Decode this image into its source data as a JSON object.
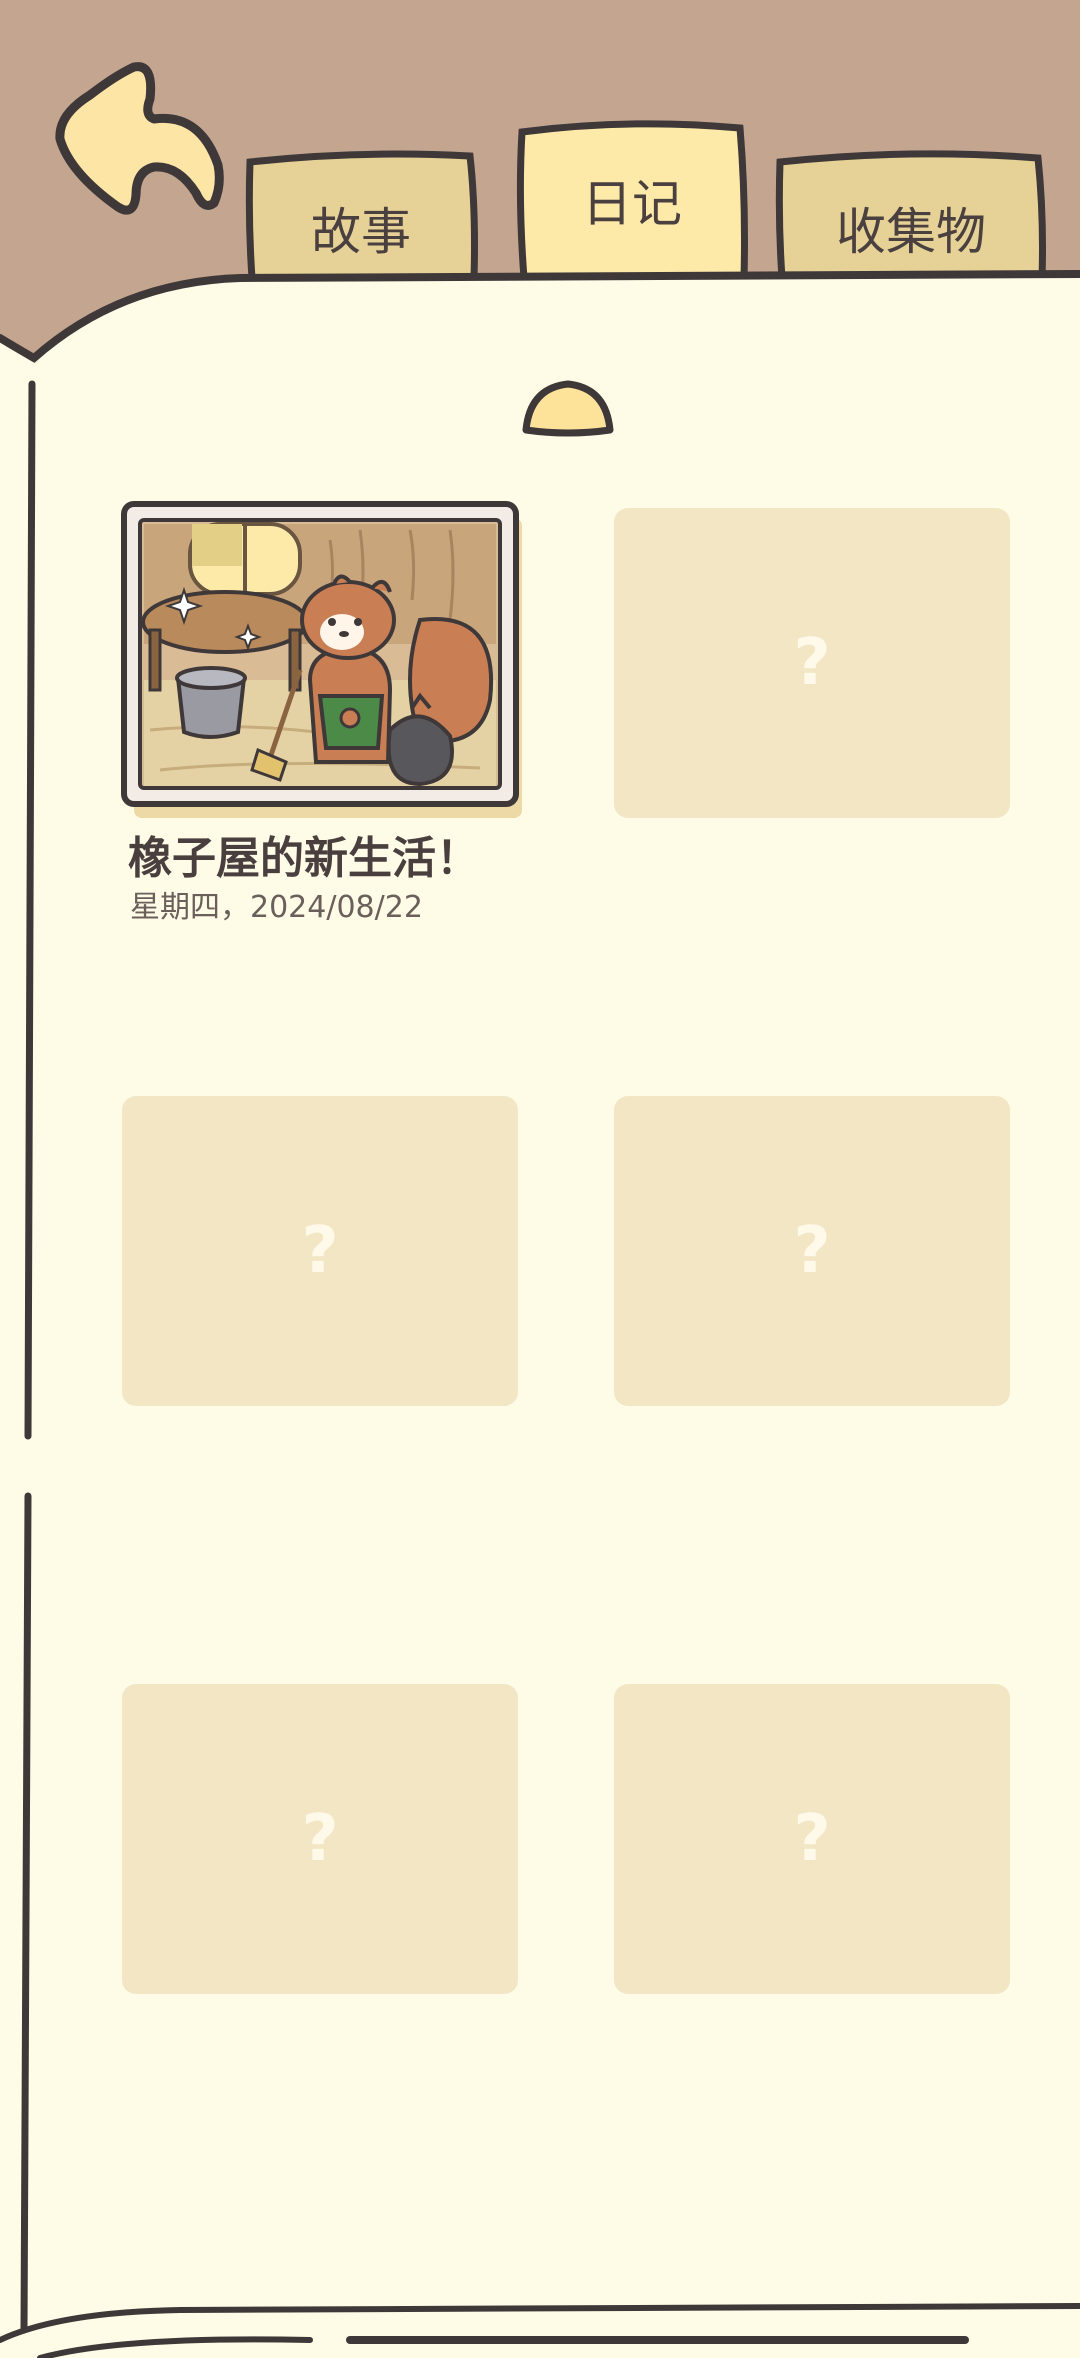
{
  "tabs": [
    {
      "label": "故事",
      "active": false
    },
    {
      "label": "日记",
      "active": true
    },
    {
      "label": "收集物",
      "active": false
    }
  ],
  "entries": [
    {
      "title": "橡子屋的新生活！",
      "date": "星期四，2024/08/22",
      "unlocked": true
    },
    {
      "locked_label": "?",
      "unlocked": false
    },
    {
      "locked_label": "?",
      "unlocked": false
    },
    {
      "locked_label": "?",
      "unlocked": false
    },
    {
      "locked_label": "?",
      "unlocked": false
    },
    {
      "locked_label": "?",
      "unlocked": false
    }
  ],
  "colors": {
    "background": "#c4a590",
    "page": "#fefbe6",
    "tab_inactive": "#e6d196",
    "tab_active": "#fde9a8",
    "outline": "#3f3839",
    "locked_card": "#f2e6c5"
  },
  "icons": {
    "back": "back-arrow-icon",
    "page_indicator": "dome-indicator-icon"
  }
}
